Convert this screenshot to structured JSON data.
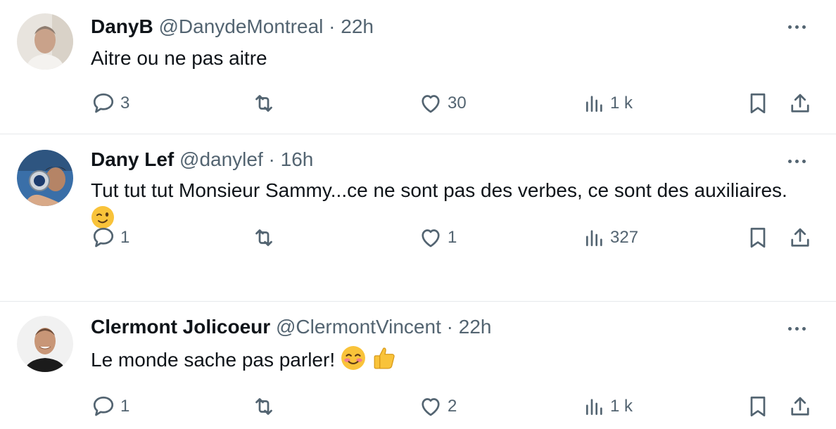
{
  "tweets": [
    {
      "name": "DanyB",
      "handle": "@DanydeMontreal",
      "separator": "·",
      "time": "22h",
      "text": "Aitre ou ne pas aitre",
      "emojis": [],
      "replies": "3",
      "retweets": "",
      "likes": "30",
      "views": "1 k"
    },
    {
      "name": "Dany Lef",
      "handle": "@danylef",
      "separator": "·",
      "time": "16h",
      "text": "Tut tut tut Monsieur Sammy...ce ne sont pas des verbes, ce sont des auxiliaires.",
      "emojis": [
        "winking-face"
      ],
      "replies": "1",
      "retweets": "",
      "likes": "1",
      "views": "327"
    },
    {
      "name": "Clermont Jolicoeur",
      "handle": "@ClermontVincent",
      "separator": "·",
      "time": "22h",
      "text": "Le monde sache pas parler!",
      "emojis": [
        "smiling-face-with-blush",
        "thumbs-up"
      ],
      "replies": "1",
      "retweets": "",
      "likes": "2",
      "views": "1 k"
    }
  ],
  "icons": {
    "reply": "speech-bubble-icon",
    "retweet": "retweet-icon",
    "like": "heart-icon",
    "views": "bar-chart-icon",
    "bookmark": "bookmark-icon",
    "share": "share-icon",
    "more": "more-dots-icon"
  },
  "colors": {
    "text": "#0f1419",
    "secondary": "#536471",
    "divider": "#e6e9ec",
    "background": "#ffffff"
  }
}
